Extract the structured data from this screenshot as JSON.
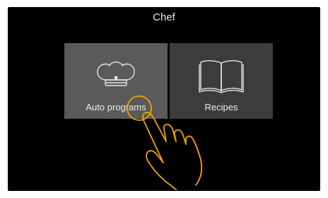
{
  "screen": {
    "title": "Chef"
  },
  "tiles": [
    {
      "label": "Auto programs",
      "icon": "chef-hat-icon",
      "state": "pressed"
    },
    {
      "label": "Recipes",
      "icon": "book-icon",
      "state": "normal"
    }
  ],
  "gesture": {
    "icon": "tap-hand-icon"
  },
  "colors": {
    "background": "#000000",
    "tile_pressed": "#5a5a5a",
    "tile_normal": "#3c3c3c",
    "text": "#e8e8e8",
    "gesture": "#f0a500"
  }
}
